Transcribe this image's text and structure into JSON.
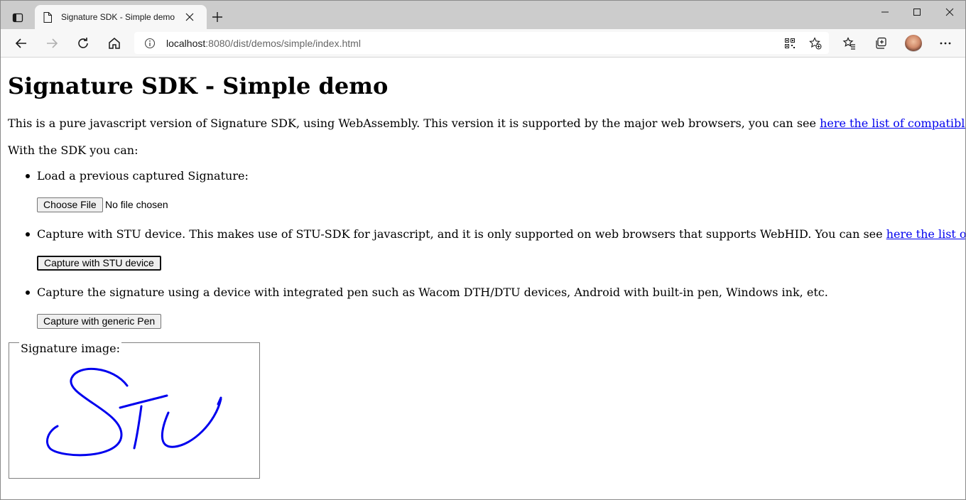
{
  "browser": {
    "tab_title": "Signature SDK - Simple demo",
    "url_host": "localhost",
    "url_rest": ":8080/dist/demos/simple/index.html"
  },
  "page": {
    "heading": "Signature SDK - Simple demo",
    "intro_text": "This is a pure javascript version of Signature SDK, using WebAssembly. This version it is supported by the major web browsers, you can see ",
    "intro_link": "here the list of compatible browsers",
    "intro_end": ".",
    "sdk_can": "With the SDK you can:",
    "item1": "Load a previous captured Signature:",
    "choose_file_label": "Choose File",
    "no_file_text": "No file chosen",
    "item2_text": "Capture with STU device. This makes use of STU-SDK for javascript, and it is only supported on web browsers that supports WebHID. You can see ",
    "item2_link": "here the list of compatible browsers",
    "item2_end": ".",
    "stu_button": "Capture with STU device",
    "item3": "Capture the signature using a device with integrated pen such as Wacom DTH/DTU devices, Android with built-in pen, Windows ink, etc.",
    "pen_button": "Capture with generic Pen",
    "signature_legend": "Signature image:",
    "signature_handwriting": "STU"
  },
  "colors": {
    "link": "#0000ee",
    "signature_ink": "#0000ee",
    "tabstrip": "#cccccc",
    "toolbar": "#f7f7f7"
  },
  "icons": [
    "tab-actions-icon",
    "page-icon",
    "close-icon",
    "plus-icon",
    "minimize-icon",
    "maximize-icon",
    "window-close-icon",
    "back-icon",
    "forward-icon",
    "refresh-icon",
    "home-icon",
    "info-icon",
    "qr-icon",
    "add-favorite-icon",
    "favorites-icon",
    "collections-icon",
    "profile-avatar",
    "more-icon"
  ]
}
